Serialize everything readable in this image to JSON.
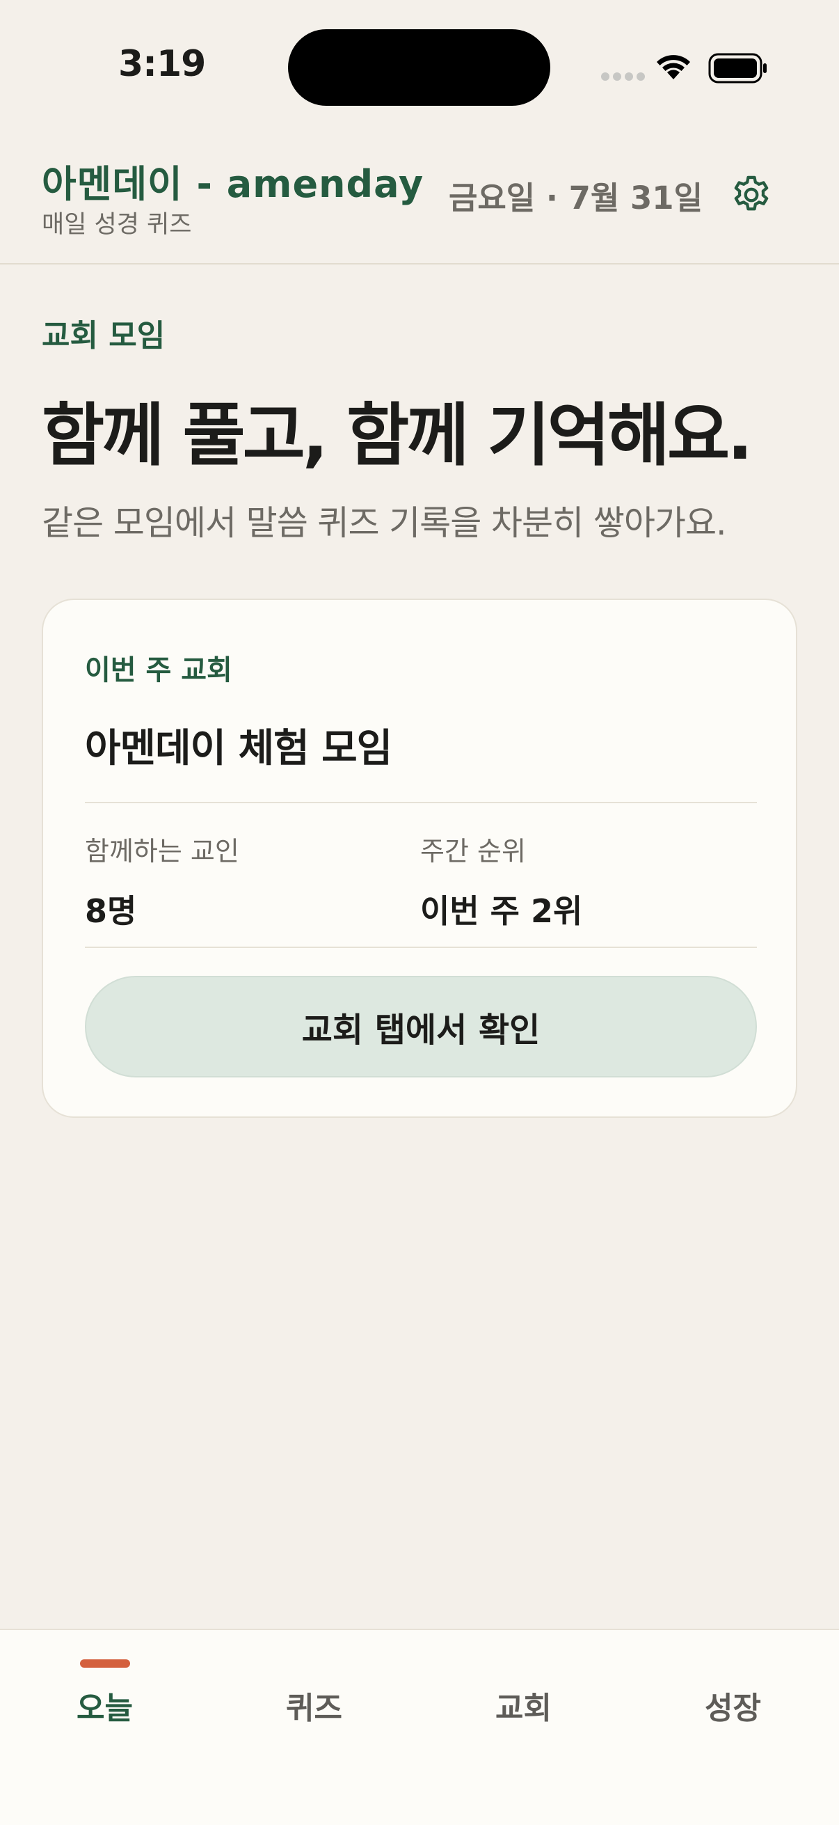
{
  "status_bar": {
    "time": "3:19"
  },
  "header": {
    "app_title": "아멘데이 - amenday",
    "app_subtitle": "매일 성경 퀴즈",
    "date_label": "금요일 · 7월 31일",
    "settings_icon": "gear-icon"
  },
  "hero": {
    "section_label": "교회 모임",
    "headline": "함께 풀고, 함께 기억해요.",
    "lede": "같은 모임에서 말씀 퀴즈 기록을 차분히 쌓아가요."
  },
  "church_card": {
    "kicker": "이번 주 교회",
    "title": "아멘데이 체험 모임",
    "stats": [
      {
        "label": "함께하는 교인",
        "value": "8명"
      },
      {
        "label": "주간 순위",
        "value": "이번 주 2위"
      }
    ],
    "button_label": "교회 탭에서 확인"
  },
  "tab_bar": {
    "tabs": [
      {
        "label": "오늘",
        "active": true
      },
      {
        "label": "퀴즈",
        "active": false
      },
      {
        "label": "교회",
        "active": false
      },
      {
        "label": "성장",
        "active": false
      }
    ]
  },
  "colors": {
    "background": "#f4f0ea",
    "accent_green": "#255b40",
    "card_surface": "#fdfcf8",
    "button_fill": "#dde8e0",
    "tab_indicator": "#d4603e",
    "muted_text": "#6d6a64"
  }
}
